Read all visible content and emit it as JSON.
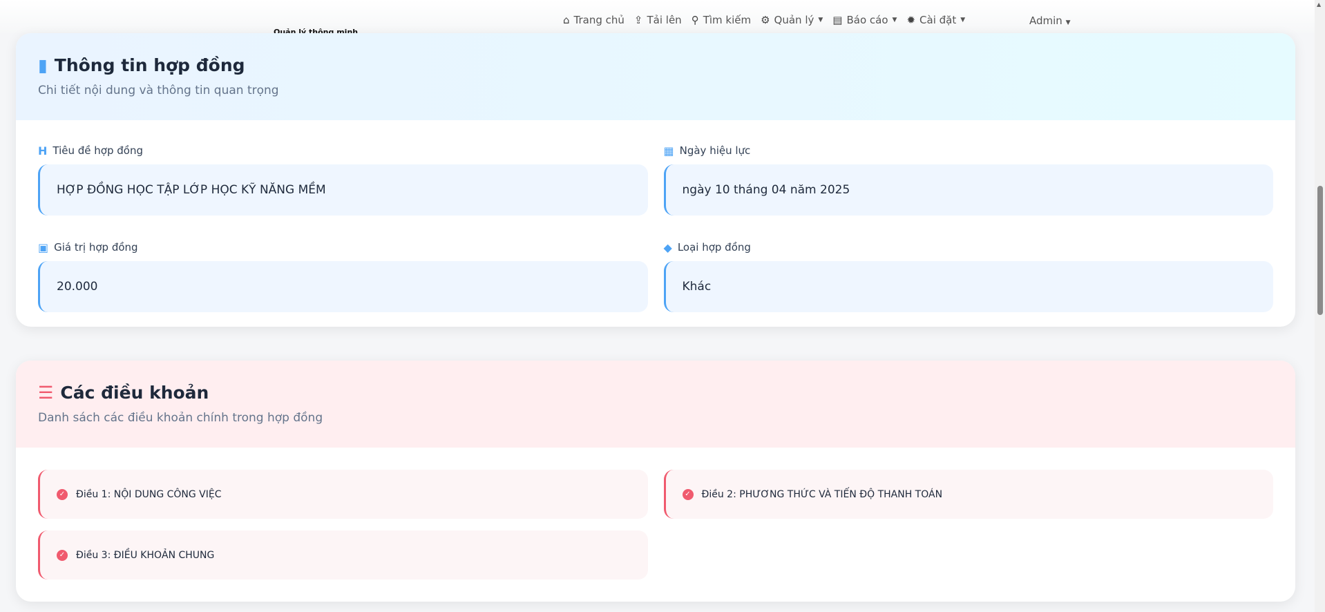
{
  "brand": "Quản lý thông minh",
  "nav": [
    {
      "icon": "home-icon",
      "label": "Trang chủ"
    },
    {
      "icon": "upload-icon",
      "label": "Tải lên"
    },
    {
      "icon": "search-icon",
      "label": "Tìm kiếm"
    },
    {
      "icon": "gears-icon",
      "label": "Quản lý",
      "dropdown": true
    },
    {
      "icon": "chart-icon",
      "label": "Báo cáo",
      "dropdown": true
    },
    {
      "icon": "gear-icon",
      "label": "Cài đặt",
      "dropdown": true
    }
  ],
  "user": "Admin",
  "info": {
    "title": "Thông tin hợp đồng",
    "subtitle": "Chi tiết nội dung và thông tin quan trọng",
    "fields": [
      {
        "label": "Tiêu đề hợp đồng",
        "value": "HỢP ĐỒNG HỌC TẬP LỚP HỌC KỸ NĂNG MỀM"
      },
      {
        "label": "Ngày hiệu lực",
        "value": "ngày 10 tháng 04 năm 2025"
      },
      {
        "label": "Giá trị hợp đồng",
        "value": "20.000"
      },
      {
        "label": "Loại hợp đồng",
        "value": "Khác"
      }
    ]
  },
  "terms": {
    "title": "Các điều khoản",
    "subtitle": "Danh sách các điều khoản chính trong hợp đồng",
    "items": [
      "Điều 1: NỘI DUNG CÔNG VIỆC",
      "Điều 2: PHƯƠNG THỨC VÀ TIẾN ĐỘ THANH TOÁN",
      "Điều 3: ĐIỀU KHOẢN CHUNG"
    ]
  },
  "colors": {
    "info_accent": "#4da3f5",
    "terms_accent": "#f05a6e"
  }
}
